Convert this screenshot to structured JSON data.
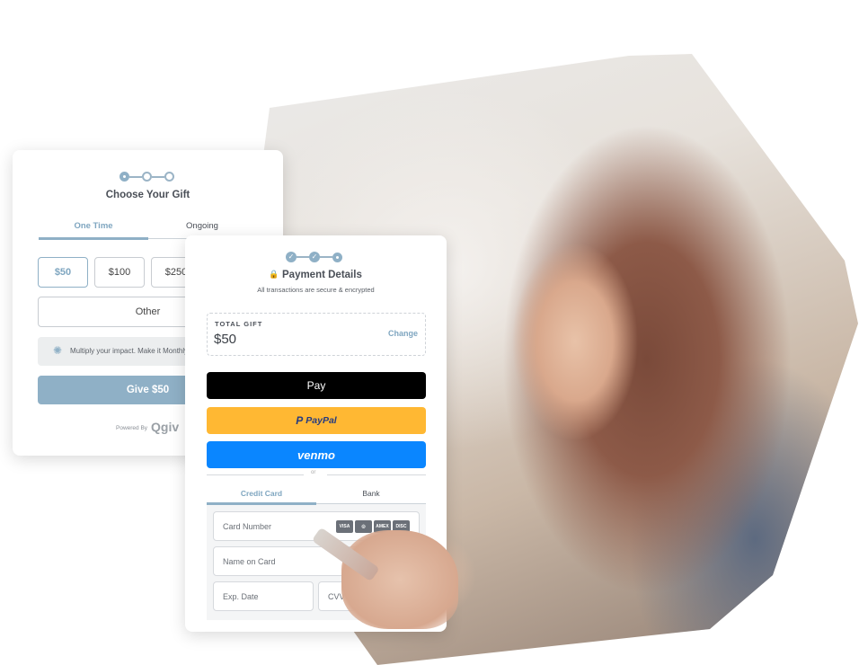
{
  "gift_card": {
    "title": "Choose Your Gift",
    "tabs": [
      "One Time",
      "Ongoing"
    ],
    "amounts": [
      "$50",
      "$100",
      "$250"
    ],
    "other": "Other",
    "tip": "Multiply your impact. Make it Monthly",
    "give_button": "Give $50",
    "powered_by": "Powered By",
    "brand": "qgiv"
  },
  "payment_card": {
    "title": "Payment Details",
    "subtitle": "All transactions are secure & encrypted",
    "total_label": "TOTAL GIFT",
    "total_value": "$50",
    "change_link": "Change",
    "apple_pay": "Pay",
    "paypal": "PayPal",
    "venmo": "venmo",
    "divider": "or",
    "tabs": [
      "Credit Card",
      "Bank"
    ],
    "fields": {
      "card_number": "Card Number",
      "name": "Name on Card",
      "exp": "Exp. Date",
      "cvv": "CVV"
    },
    "card_brands": [
      "VISA",
      "MC",
      "AMEX",
      "DISCOVER"
    ]
  },
  "colors": {
    "accent": "#8fb0c6",
    "apple": "#000000",
    "paypal": "#ffb833",
    "venmo": "#0a86ff"
  }
}
